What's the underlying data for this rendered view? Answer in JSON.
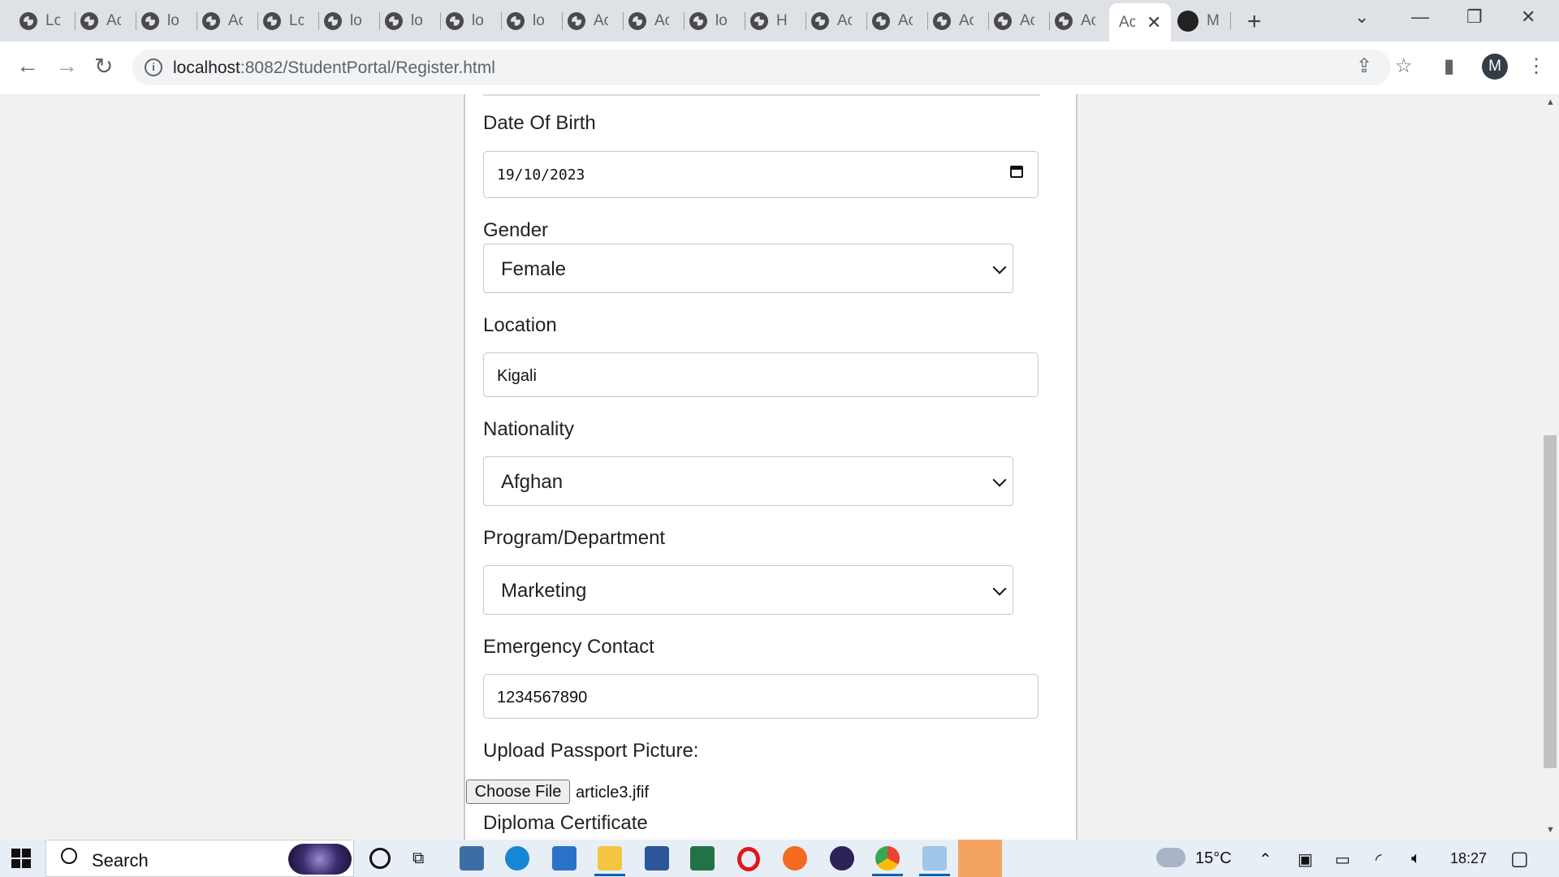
{
  "browser": {
    "tabs": [
      {
        "label": "Lo"
      },
      {
        "label": "Ac"
      },
      {
        "label": "lo"
      },
      {
        "label": "Ac"
      },
      {
        "label": "Lc"
      },
      {
        "label": "lo"
      },
      {
        "label": "lo"
      },
      {
        "label": "lo"
      },
      {
        "label": "lo"
      },
      {
        "label": "Ac"
      },
      {
        "label": "Ac"
      },
      {
        "label": "lo"
      },
      {
        "label": "H"
      },
      {
        "label": "Ac"
      },
      {
        "label": "Ac"
      },
      {
        "label": "Ac"
      },
      {
        "label": "Ac"
      },
      {
        "label": "Ac"
      }
    ],
    "active_tab": {
      "label": "Ac",
      "close": "✕"
    },
    "github_tab": {
      "label": "M"
    },
    "new_tab": "+",
    "url_host": "localhost",
    "url_path": ":8082/StudentPortal/Register.html",
    "avatar_letter": "M"
  },
  "form": {
    "dob_label": "Date Of Birth",
    "dob_value": "19/10/2023",
    "gender_label": "Gender",
    "gender_value": "Female",
    "location_label": "Location",
    "location_value": "Kigali",
    "nationality_label": "Nationality",
    "nationality_value": "Afghan",
    "program_label": "Program/Department",
    "program_value": "Marketing",
    "emergency_label": "Emergency Contact",
    "emergency_value": "1234567890",
    "passport_label": "Upload Passport Picture:",
    "passport_button": "Choose File",
    "passport_file": "article3.jfif",
    "diploma_label": "Diploma Certificate"
  },
  "taskbar": {
    "search_text": "Search",
    "weather": "15°C",
    "time": "18:27"
  }
}
